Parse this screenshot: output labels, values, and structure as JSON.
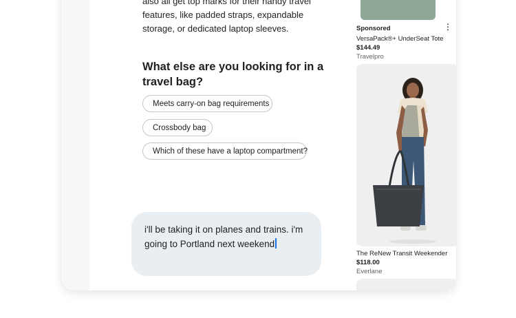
{
  "answer": {
    "text": "also all get top marks for their handy travel features, like padded straps, expandable storage, or dedicated laptop sleeves."
  },
  "followup": {
    "question": "What else are you looking for in a travel bag?",
    "chips": [
      "Meets carry-on bag requirements",
      "Crossbody bag",
      "Which of these have a laptop compartment?"
    ]
  },
  "composer": {
    "value": "i'll be taking it on planes and trains. i'm going to Portland next weekend"
  },
  "products": [
    {
      "sponsored_label": "Sponsored",
      "name": "VersaPack®+ UnderSeat Tote",
      "price": "$144.49",
      "store": "Travelpro"
    },
    {
      "name": "The ReNew Transit Weekender",
      "price": "$118.00",
      "store": "Everlane"
    }
  ],
  "colors": {
    "composer_bg": "#e9eef2",
    "caret": "#1a73e8",
    "tote_green": "#8ea897",
    "bag_dark": "#3b3f44"
  }
}
